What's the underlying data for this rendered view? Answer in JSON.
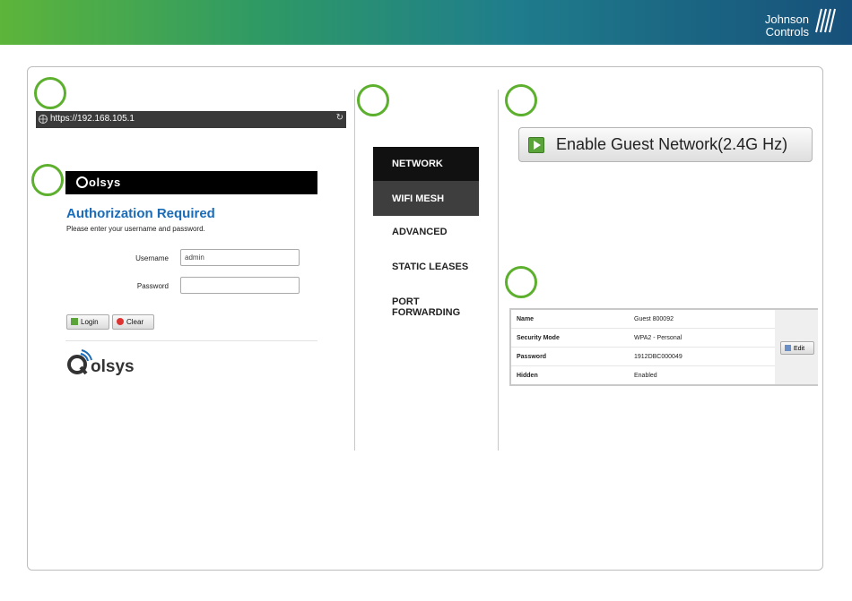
{
  "brand": {
    "line1": "Johnson",
    "line2": "Controls"
  },
  "browser": {
    "url": "https://192.168.105.1"
  },
  "login": {
    "brand": "olsys",
    "title": "Authorization Required",
    "subtitle": "Please enter your username and password.",
    "username_label": "Username",
    "username_value": "admin",
    "password_label": "Password",
    "password_value": "",
    "login_button": "Login",
    "clear_button": "Clear"
  },
  "nav": {
    "items": [
      {
        "label": "NETWORK"
      },
      {
        "label": "WIFI MESH"
      },
      {
        "label": "ADVANCED"
      },
      {
        "label": "STATIC LEASES"
      },
      {
        "label": "PORT FORWARDING"
      }
    ]
  },
  "guest": {
    "button": "Enable Guest Network(2.4G Hz)"
  },
  "table": {
    "rows": [
      {
        "key": "Name",
        "value": "Guest 800092"
      },
      {
        "key": "Security Mode",
        "value": "WPA2 - Personal"
      },
      {
        "key": "Password",
        "value": "1912DBC000049"
      },
      {
        "key": "Hidden",
        "value": "Enabled"
      }
    ],
    "edit_button": "Edit"
  },
  "colors": {
    "accent_green": "#5cb02e",
    "title_blue": "#1a6bb8"
  }
}
